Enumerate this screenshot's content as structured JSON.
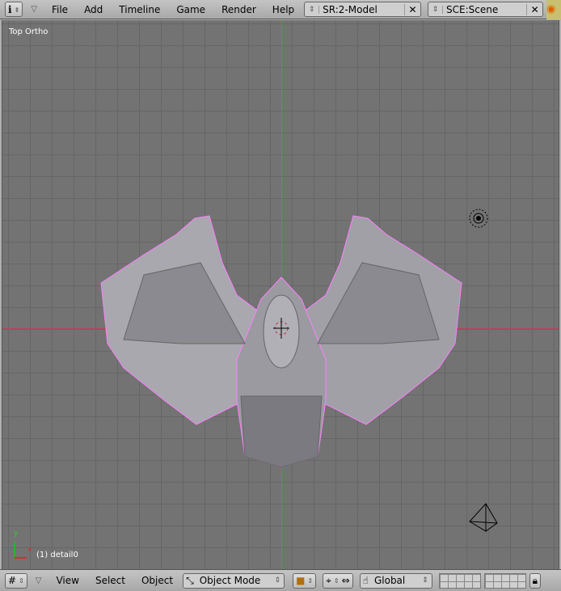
{
  "top_header": {
    "menus": [
      "File",
      "Add",
      "Timeline",
      "Game",
      "Render",
      "Help"
    ],
    "screen": "SR:2-Model",
    "scene": "SCE:Scene"
  },
  "viewport": {
    "view_label": "Top Ortho",
    "object_label": "(1) detail0",
    "axis_x": "x",
    "axis_y": "y"
  },
  "bottom_header": {
    "menus": [
      "View",
      "Select",
      "Object"
    ],
    "mode": "Object Mode",
    "orientation": "Global"
  },
  "colors": {
    "x_axis": "#c0405a",
    "y_axis": "#30b030",
    "selection": "#ff80ff"
  }
}
